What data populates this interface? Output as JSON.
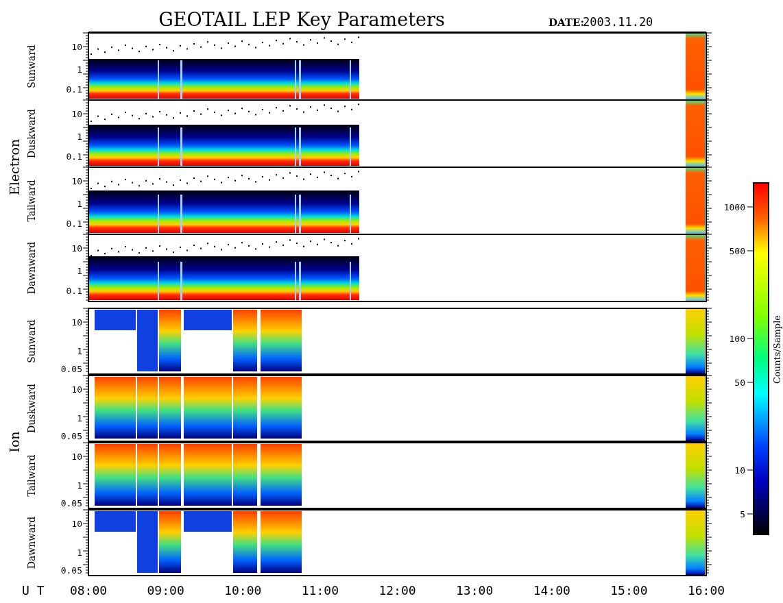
{
  "title": "GEOTAIL LEP Key Parameters",
  "date": {
    "label": "DATE:",
    "value": "2003.11.20"
  },
  "groups": [
    {
      "label": "Electron",
      "kind": "electron",
      "panels": [
        {
          "label": "Sunward",
          "yticks": [
            "10",
            "1",
            "0.1"
          ]
        },
        {
          "label": "Duskward",
          "yticks": [
            "10",
            "1",
            "0.1"
          ]
        },
        {
          "label": "Tailward",
          "yticks": [
            "10",
            "1",
            "0.1"
          ]
        },
        {
          "label": "Dawnward",
          "yticks": [
            "10",
            "1",
            "0.1"
          ]
        }
      ]
    },
    {
      "label": "Ion",
      "kind": "ion",
      "panels": [
        {
          "label": "Sunward",
          "yticks": [
            "10",
            "1",
            "0.05"
          ]
        },
        {
          "label": "Duskward",
          "yticks": [
            "10",
            "1",
            "0.05"
          ]
        },
        {
          "label": "Tailward",
          "yticks": [
            "10",
            "1",
            "0.05"
          ]
        },
        {
          "label": "Dawnward",
          "yticks": [
            "10",
            "1",
            "0.05"
          ]
        }
      ]
    }
  ],
  "colorbar": {
    "label": "Counts/Sample",
    "ticks": [
      "1000",
      "500",
      "100",
      "50",
      "10",
      "5"
    ]
  },
  "x_axis": {
    "label": "U T",
    "ticks": [
      "08:00",
      "09:00",
      "10:00",
      "11:00",
      "12:00",
      "13:00",
      "14:00",
      "15:00",
      "16:00"
    ]
  }
}
